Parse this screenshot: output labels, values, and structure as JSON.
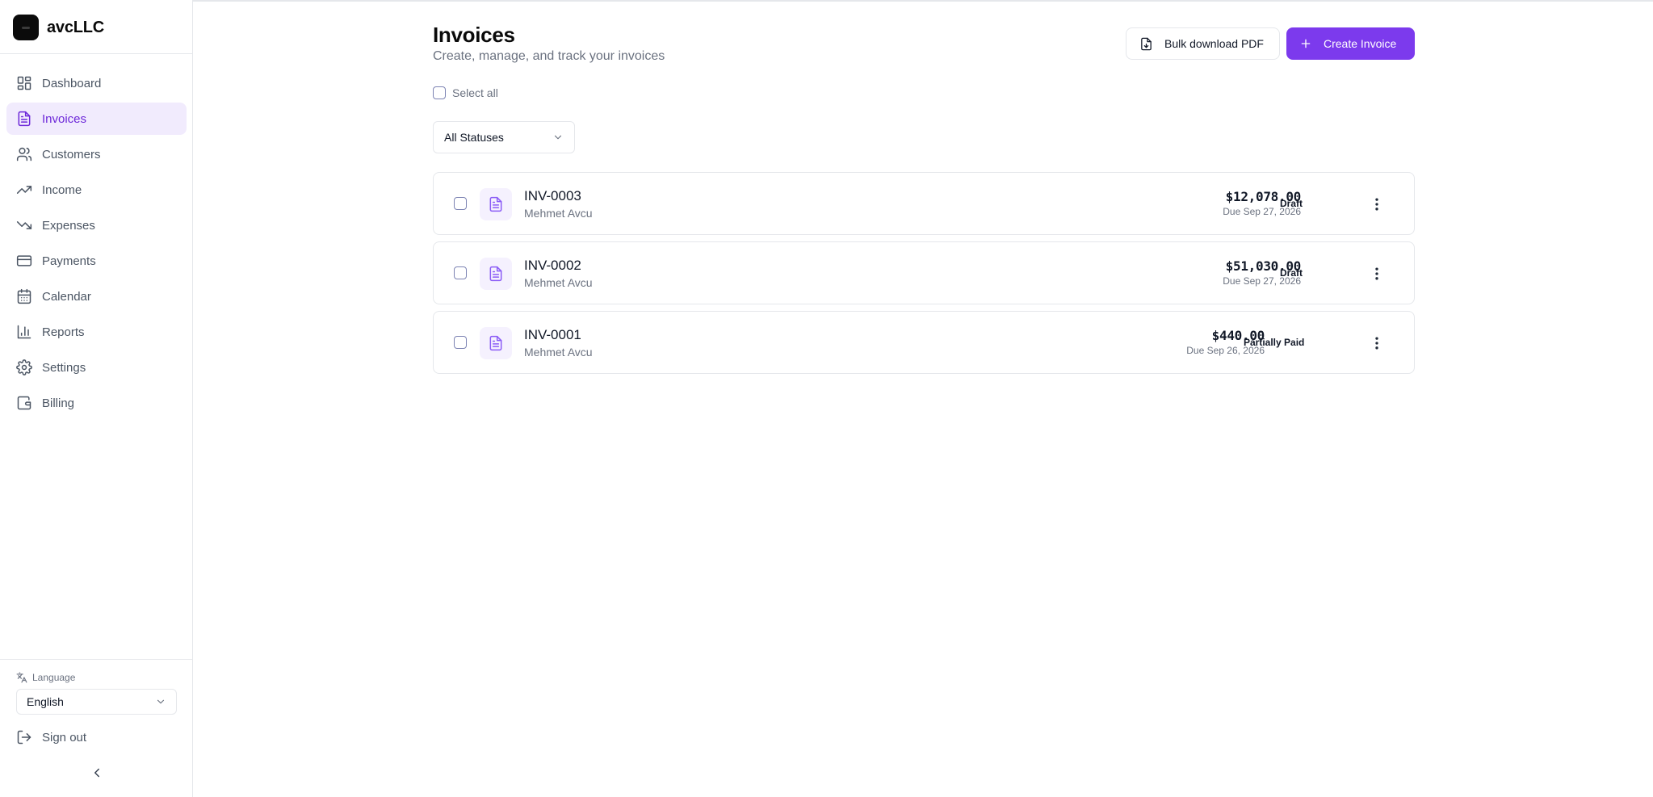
{
  "brand": {
    "name": "avcLLC"
  },
  "sidebar": {
    "items": [
      {
        "label": "Dashboard",
        "icon": "dashboard-icon",
        "active": false
      },
      {
        "label": "Invoices",
        "icon": "file-text-icon",
        "active": true
      },
      {
        "label": "Customers",
        "icon": "users-icon",
        "active": false
      },
      {
        "label": "Income",
        "icon": "trending-up-icon",
        "active": false
      },
      {
        "label": "Expenses",
        "icon": "trending-down-icon",
        "active": false
      },
      {
        "label": "Payments",
        "icon": "credit-card-icon",
        "active": false
      },
      {
        "label": "Calendar",
        "icon": "calendar-icon",
        "active": false
      },
      {
        "label": "Reports",
        "icon": "bar-chart-icon",
        "active": false
      },
      {
        "label": "Settings",
        "icon": "gear-icon",
        "active": false
      },
      {
        "label": "Billing",
        "icon": "wallet-icon",
        "active": false
      }
    ],
    "language_label": "Language",
    "language_value": "English",
    "signout_label": "Sign out"
  },
  "header": {
    "title": "Invoices",
    "subtitle": "Create, manage, and track your invoices",
    "bulk_download_label": "Bulk download PDF",
    "create_label": "Create Invoice"
  },
  "filters": {
    "select_all_label": "Select all",
    "status_value": "All Statuses"
  },
  "invoices": [
    {
      "number": "INV-0003",
      "customer": "Mehmet Avcu",
      "amount": "$12,078.00",
      "due": "Due Sep 27, 2026",
      "status": "Draft"
    },
    {
      "number": "INV-0002",
      "customer": "Mehmet Avcu",
      "amount": "$51,030.00",
      "due": "Due Sep 27, 2026",
      "status": "Draft"
    },
    {
      "number": "INV-0001",
      "customer": "Mehmet Avcu",
      "amount": "$440.00",
      "due": "Due Sep 26, 2026",
      "status": "Partially Paid"
    }
  ],
  "colors": {
    "accent": "#7c3aed",
    "active_nav_bg": "#f1ebfd",
    "active_nav_text": "#6d28d9",
    "border": "#e5e7eb",
    "muted_text": "#6b7280"
  }
}
